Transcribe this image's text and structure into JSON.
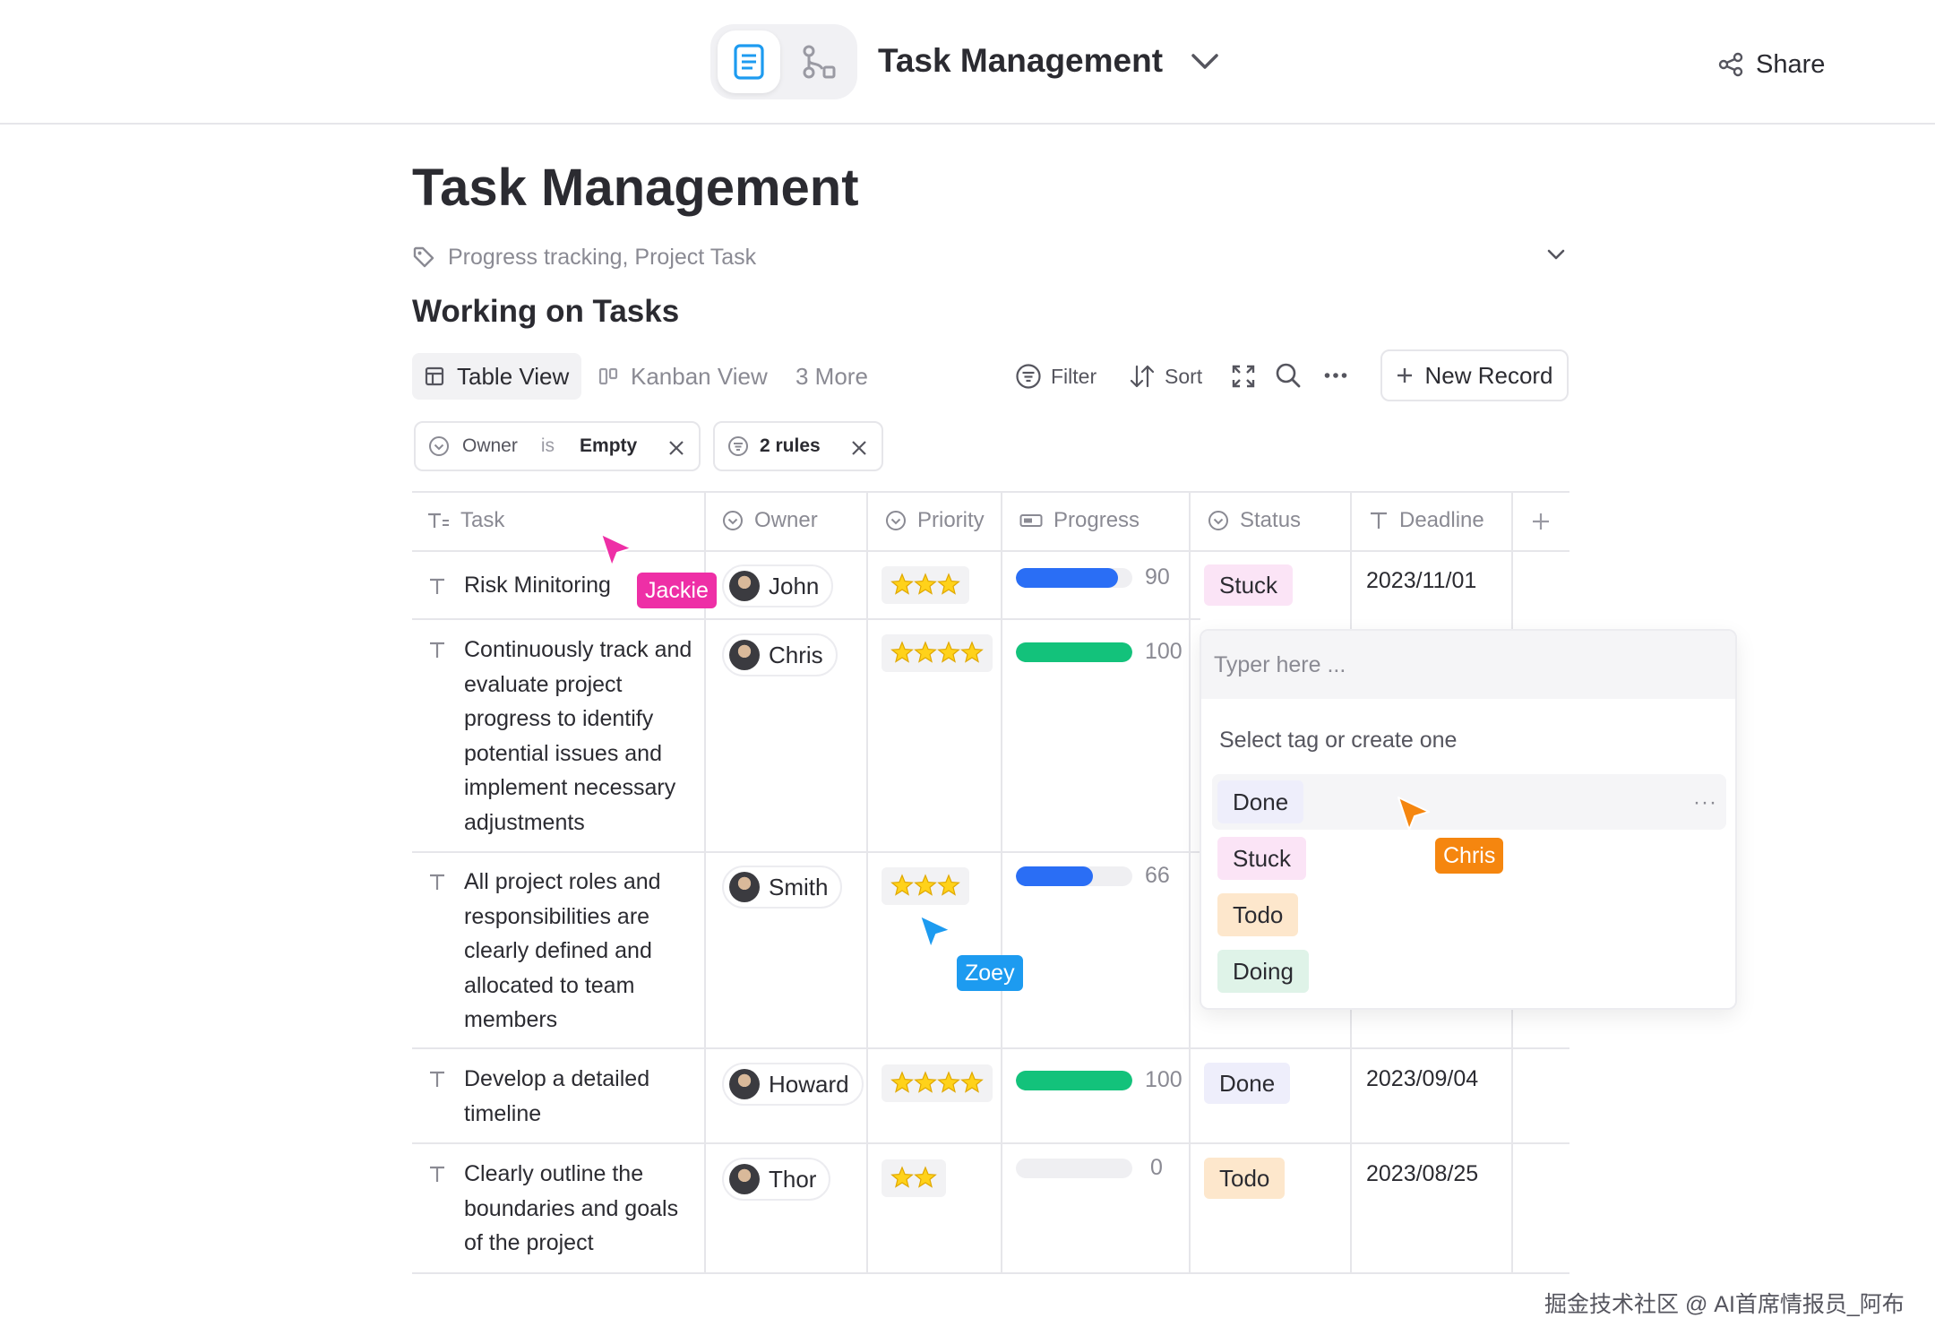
{
  "header": {
    "title": "Task Management",
    "share_label": "Share"
  },
  "page": {
    "title": "Task Management",
    "tags": "Progress tracking, Project Task",
    "section_title": "Working on Tasks"
  },
  "views": {
    "table": "Table View",
    "kanban": "Kanban View",
    "more": "3 More"
  },
  "toolbar": {
    "filter": "Filter",
    "sort": "Sort",
    "new_record": "New Record"
  },
  "filters": {
    "owner_field": "Owner",
    "owner_op": "is",
    "owner_value": "Empty",
    "rules": "2 rules"
  },
  "columns": [
    "Task",
    "Owner",
    "Priority",
    "Progress",
    "Status",
    "Deadline"
  ],
  "rows": [
    {
      "task": "Risk Minitoring",
      "owner": "John",
      "priority": "3/4",
      "progress": "90",
      "status": "Stuck",
      "deadline": "2023/11/01"
    },
    {
      "task": "Continuously track and evaluate project progress to identify potential issues and implement necessary adjustments",
      "owner": "Chris",
      "priority": "4/4",
      "progress": "100",
      "status": "",
      "deadline": ""
    },
    {
      "task": "All project roles and responsibilities are clearly defined and allocated to team members",
      "owner": "Smith",
      "priority": "3/4",
      "progress": "66",
      "status": "",
      "deadline": ""
    },
    {
      "task": "Develop a detailed timeline",
      "owner": "Howard",
      "priority": "4/4",
      "progress": "100",
      "status": "Done",
      "deadline": "2023/09/04"
    },
    {
      "task": "Clearly outline the boundaries and goals of the project",
      "owner": "Thor",
      "priority": "2/4",
      "progress": "0",
      "status": "Todo",
      "deadline": "2023/08/25"
    }
  ],
  "popover": {
    "placeholder": "Typer here ...",
    "label": "Select tag or create one",
    "options": [
      "Done",
      "Stuck",
      "Todo",
      "Doing"
    ],
    "more": "···"
  },
  "cursors": {
    "jackie": "Jackie",
    "zoey": "Zoey",
    "chris": "Chris"
  },
  "colors": {
    "jackie": "#ee2fa6",
    "zoey": "#1d9bf0",
    "chris": "#f5860f",
    "progress_blue": "#2a6ef5",
    "progress_green": "#13c27b",
    "tag_stuck": "#fbe4f6",
    "tag_done": "#eeeefb",
    "tag_todo": "#fde7cc",
    "tag_doing": "#dff3e8"
  },
  "watermark": "掘金技术社区 @ AI首席情报员_阿布"
}
